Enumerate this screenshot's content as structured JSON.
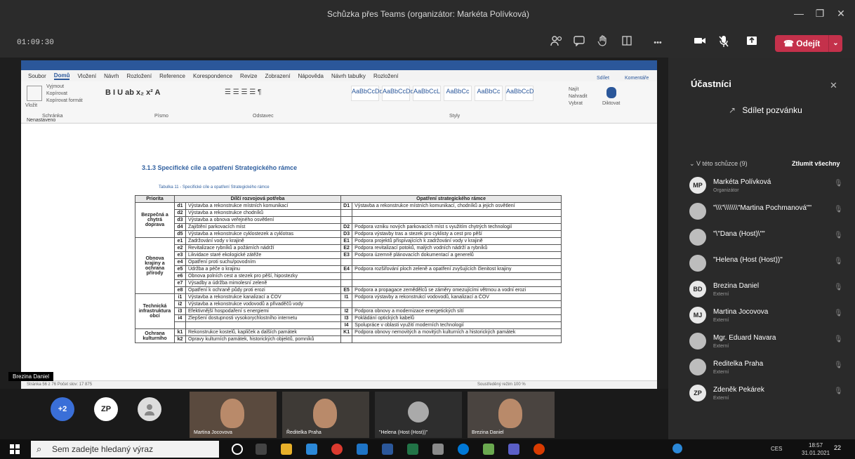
{
  "window": {
    "title": "Schůzka přes Teams (organizátor: Markéta Polívková)",
    "minimize_glyph": "—",
    "restore_glyph": "❐",
    "close_glyph": "✕"
  },
  "toolbar": {
    "timer": "01:09:30",
    "more_glyph": "•••",
    "leave_label": "Odejít",
    "leave_chevron": "⌄",
    "icons": [
      "participants-icon",
      "chat-icon",
      "raise-hand-icon",
      "rooms-icon",
      "more-icon",
      "camera-icon",
      "mic-off-icon",
      "share-icon"
    ]
  },
  "word": {
    "tabs": [
      "Soubor",
      "Domů",
      "Vložení",
      "Návrh",
      "Rozložení",
      "Reference",
      "Korespondence",
      "Revize",
      "Zobrazení",
      "Nápověda",
      "Návrh tabulky",
      "Rozložení"
    ],
    "active_tab": "Domů",
    "ribbon": {
      "clipboard": "Vložit",
      "cut": "Vyjmout",
      "copy": "Kopírovat",
      "format_painter": "Kopírovat formát",
      "clipboard_group": "Schránka",
      "font_group": "Písmo",
      "paragraph_group": "Odstavec",
      "styles_group": "Styly",
      "find": "Najít",
      "replace": "Nahradit",
      "select": "Vybrat",
      "dictate": "Diktovat",
      "share": "Sdílet",
      "comments": "Komentáře",
      "sensitivity": "Nenastaveno",
      "styles": [
        "AaBbCcDd",
        "AaBbCcDd",
        "AaBbCcL",
        "AaBbCc",
        "AaBbCc",
        "AaBbCcD"
      ]
    },
    "heading": "3.1.3 Specifické cíle a opatření Strategického rámce",
    "caption": "Tabulka 11 - Specifické cíle a opatření Strategického rámce",
    "table": {
      "headers": [
        "Priorita",
        "Dílčí rozvojová potřeba",
        "Opatření strategického rámce"
      ],
      "groups": [
        {
          "priority": "Bezpečná a chytrá doprava",
          "rows": [
            {
              "code": "d1",
              "need": "Výstavba a rekonstrukce místních komunikací",
              "mcode": "D1",
              "measure": "Výstavba a rekonstrukce místních komunikací, chodníků a jejich osvětlení"
            },
            {
              "code": "d2",
              "need": "Výstavba a rekonstrukce chodníků",
              "mcode": "",
              "measure": ""
            },
            {
              "code": "d3",
              "need": "Výstavba a obnova veřejného osvětlení",
              "mcode": "",
              "measure": ""
            },
            {
              "code": "d4",
              "need": "Zajištění parkovacích míst",
              "mcode": "D2",
              "measure": "Podpora vzniku nových parkovacích míst s využitím chytrých technologií"
            },
            {
              "code": "d5",
              "need": "Výstavba a rekonstrukce cyklostezek a cyklotras",
              "mcode": "D3",
              "measure": "Podpora výstavby tras a stezek pro cyklisty a cest pro pěší"
            }
          ]
        },
        {
          "priority": "Obnova krajiny a ochrana přírody",
          "rows": [
            {
              "code": "e1",
              "need": "Zadržování vody v krajině",
              "mcode": "E1",
              "measure": "Podpora projektů přispívajících k zadržování vody v krajině"
            },
            {
              "code": "e2",
              "need": "Revitalizace rybníků a požárních nádrží",
              "mcode": "E2",
              "measure": "Podpora revitalizací potoků, malých vodních nádrží a rybníků"
            },
            {
              "code": "e3",
              "need": "Likvidace staré ekologické zátěže",
              "mcode": "E3",
              "measure": "Podpora územně plánovacích dokumentací a generelů"
            },
            {
              "code": "e4",
              "need": "Opatření proti suchu/povodním",
              "mcode": "",
              "measure": ""
            },
            {
              "code": "e5",
              "need": "Údržba a péče o krajinu",
              "mcode": "E4",
              "measure": "Podpora rozšiřování ploch zeleně a opatření zvyšujících členitost krajiny"
            },
            {
              "code": "e6",
              "need": "Obnova polních cest a stezek pro pěší, hipostezky",
              "mcode": "",
              "measure": ""
            },
            {
              "code": "e7",
              "need": "Výsadby a údržba mimolesní zeleně",
              "mcode": "",
              "measure": ""
            },
            {
              "code": "e8",
              "need": "Opatření k ochraně půdy proti erozi",
              "mcode": "E5",
              "measure": "Podpora a propagace zemědělců se záměry omezujícími větrnou a vodní erozi"
            }
          ]
        },
        {
          "priority": "Technická infrastruktura obcí",
          "rows": [
            {
              "code": "i1",
              "need": "Výstavba a rekonstrukce kanalizací a ČOV",
              "mcode": "I1",
              "measure": "Podpora výstavby a rekonstrukcí vodovodů, kanalizací a ČOV"
            },
            {
              "code": "i2",
              "need": "Výstavba a rekonstrukce vodovodů a přivaděčů vody",
              "mcode": "",
              "measure": ""
            },
            {
              "code": "i3",
              "need": "Efektivnější hospodaření s energiemi",
              "mcode": "I2",
              "measure": "Podpora obnovy a modernizace energetických sítí"
            },
            {
              "code": "i4",
              "need": "Zlepšení dostupnosti vysokorychlostního internetu",
              "mcode": "I3",
              "measure": "Pokládání optických kabelů"
            },
            {
              "code": "",
              "need": "",
              "mcode": "I4",
              "measure": "Spolupráce v oblasti využití moderních technologií"
            }
          ]
        },
        {
          "priority": "Ochrana kulturního",
          "rows": [
            {
              "code": "k1",
              "need": "Rekonstrukce kostelů, kapliček a dalších památek",
              "mcode": "K1",
              "measure": "Podpora obnovy nemovitých a movitých kulturních a historických památek"
            },
            {
              "code": "k2",
              "need": "Opravy kulturních památek, historických objektů, pomníků",
              "mcode": "",
              "measure": ""
            }
          ]
        }
      ]
    },
    "status_left": "Stránka 56 z 76   Počet slov: 17 875",
    "status_right": "Soustředěný režim   100 %"
  },
  "presenter_tag": "Brezina Daniel",
  "panel": {
    "title": "Účastníci",
    "invite_label": "Sdílet pozvánku",
    "section_label": "V této schůzce (9)",
    "mute_all": "Ztlumit všechny",
    "participants": [
      {
        "initials": "MP",
        "name": "Markéta Polívková",
        "role": "Organizátor",
        "avatar_color": "#e8e8e8"
      },
      {
        "initials": "",
        "name": "\"\\\\\\\"\\\\\\\\\\\\\\\"Martina Pochmanová\"\"",
        "role": "",
        "avatar_color": "#bdbdbd"
      },
      {
        "initials": "",
        "name": "\"\\\"Dana (Host)\\\"\"",
        "role": "",
        "avatar_color": "#bdbdbd"
      },
      {
        "initials": "",
        "name": "\"Helena (Host (Host))\"",
        "role": "",
        "avatar_color": "#bdbdbd"
      },
      {
        "initials": "BD",
        "name": "Brezina Daniel",
        "role": "Externí",
        "avatar_color": "#e8e8e8"
      },
      {
        "initials": "MJ",
        "name": "Martina Jocovova",
        "role": "Externí",
        "avatar_color": "#e8e8e8"
      },
      {
        "initials": "",
        "name": "Mgr. Eduard Navara",
        "role": "Externí",
        "avatar_color": "#bdbdbd"
      },
      {
        "initials": "",
        "name": "Ředitelka Praha",
        "role": "Externí",
        "avatar_color": "#bdbdbd"
      },
      {
        "initials": "ZP",
        "name": "Zdeněk Pekárek",
        "role": "Externí",
        "avatar_color": "#e8e8e8"
      }
    ]
  },
  "video_strip": {
    "overflow": "+2",
    "zp_initials": "ZP",
    "tiles": [
      "Martina Jocovova",
      "Ředitelka Praha",
      "\"Helena (Host (Host))\"",
      "Brezina Daniel"
    ]
  },
  "taskbar": {
    "search_placeholder": "Sem zadejte hledaný výraz",
    "language": "CES",
    "time": "18:57",
    "date": "31.01.2021",
    "notifications": "22"
  }
}
